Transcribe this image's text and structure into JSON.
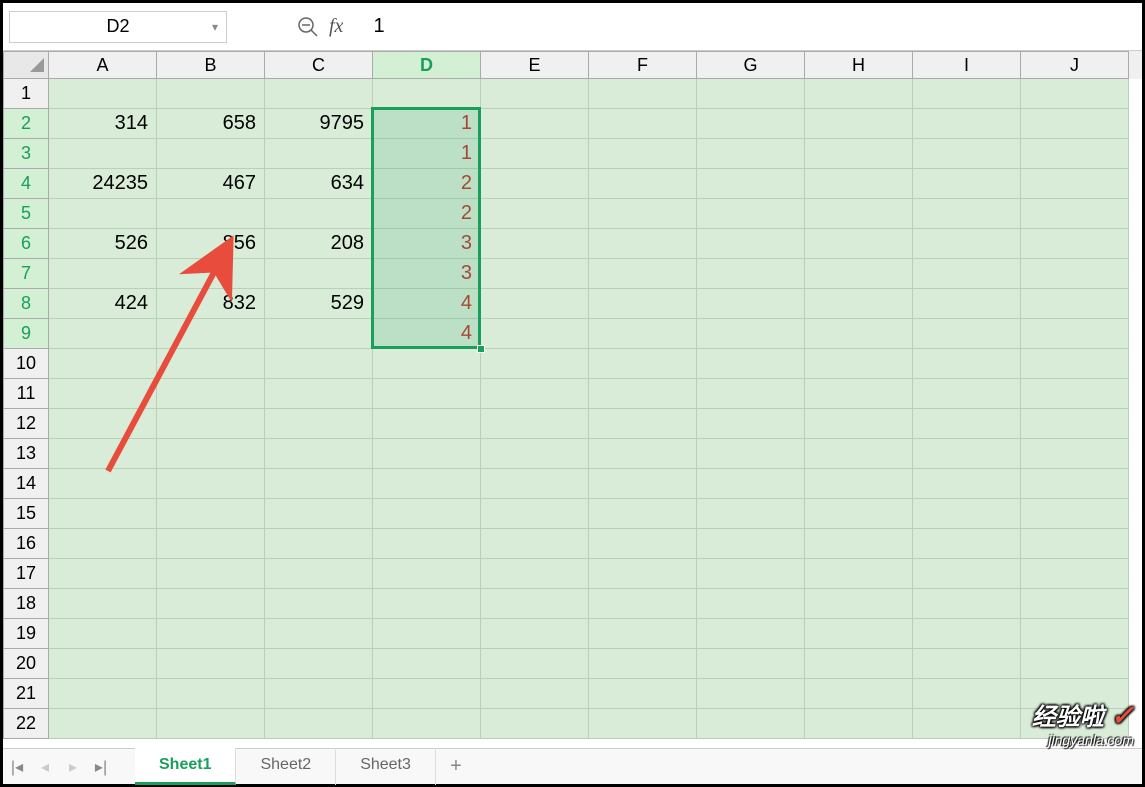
{
  "formulaBar": {
    "cellRef": "D2",
    "fxLabel": "fx",
    "formulaValue": "1"
  },
  "columns": [
    "A",
    "B",
    "C",
    "D",
    "E",
    "F",
    "G",
    "H",
    "I",
    "J"
  ],
  "activeColumn": "D",
  "rows": [
    1,
    2,
    3,
    4,
    5,
    6,
    7,
    8,
    9,
    10,
    11,
    12,
    13,
    14,
    15,
    16,
    17,
    18,
    19,
    20,
    21,
    22
  ],
  "activeRows": [
    2,
    3,
    4,
    5,
    6,
    7,
    8,
    9
  ],
  "cellData": {
    "2": {
      "A": "314",
      "B": "658",
      "C": "9795",
      "D": "1"
    },
    "3": {
      "D": "1"
    },
    "4": {
      "A": "24235",
      "B": "467",
      "C": "634",
      "D": "2"
    },
    "5": {
      "D": "2"
    },
    "6": {
      "A": "526",
      "B": "856",
      "C": "208",
      "D": "3"
    },
    "7": {
      "D": "3"
    },
    "8": {
      "A": "424",
      "B": "832",
      "C": "529",
      "D": "4"
    },
    "9": {
      "D": "4"
    }
  },
  "redColumn": "D",
  "selection": {
    "col": "D",
    "startRow": 2,
    "endRow": 9
  },
  "sheets": {
    "tabs": [
      "Sheet1",
      "Sheet2",
      "Sheet3"
    ],
    "active": "Sheet1"
  },
  "watermark": {
    "top": "经验啦",
    "check": "✓",
    "bottom": "jingyanla.com"
  }
}
